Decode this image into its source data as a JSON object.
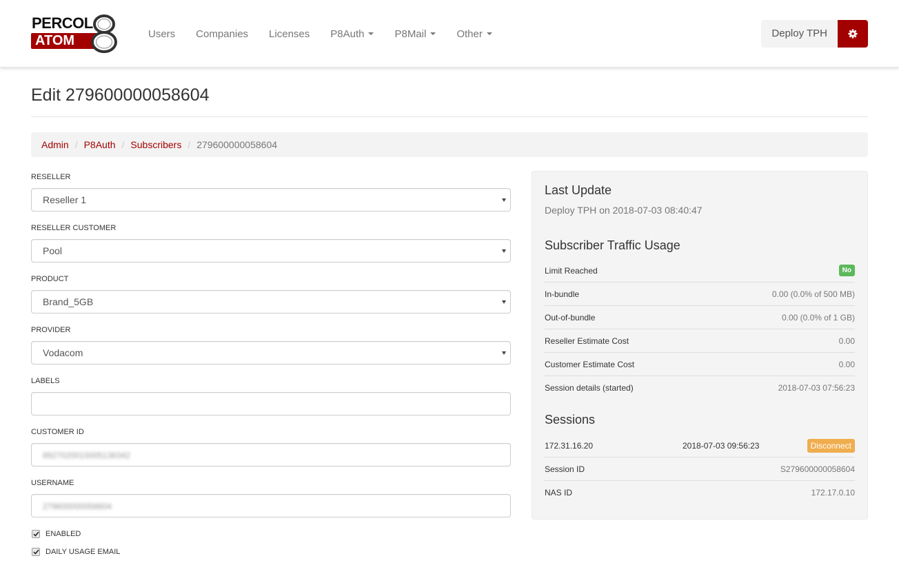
{
  "brand": {
    "line1": "PERCOL",
    "line2": "ATOM",
    "mark": "8",
    "accent_color": "#a30000"
  },
  "nav": {
    "items": [
      {
        "label": "Users",
        "dropdown": false
      },
      {
        "label": "Companies",
        "dropdown": false
      },
      {
        "label": "Licenses",
        "dropdown": false
      },
      {
        "label": "P8Auth",
        "dropdown": true
      },
      {
        "label": "P8Mail",
        "dropdown": true
      },
      {
        "label": "Other",
        "dropdown": true
      }
    ],
    "deploy_label": "Deploy TPH",
    "settings_icon": "gear-icon"
  },
  "page": {
    "title": "Edit 279600000058604"
  },
  "breadcrumb": {
    "items": [
      "Admin",
      "P8Auth",
      "Subscribers"
    ],
    "current": "279600000058604",
    "separator": "/"
  },
  "form": {
    "reseller": {
      "label": "RESELLER",
      "value": "Reseller 1"
    },
    "reseller_customer": {
      "label": "RESELLER CUSTOMER",
      "value": "Pool"
    },
    "product": {
      "label": "PRODUCT",
      "value": "Brand_5GB"
    },
    "provider": {
      "label": "PROVIDER",
      "value": "Vodacom"
    },
    "labels": {
      "label": "LABELS",
      "value": ""
    },
    "customer_id": {
      "label": "CUSTOMER ID",
      "value": "8927020015005136342"
    },
    "username": {
      "label": "USERNAME",
      "value": "279600000058604"
    },
    "enabled": {
      "label": "ENABLED",
      "checked": true
    },
    "daily_usage_email": {
      "label": "DAILY USAGE EMAIL",
      "checked": true
    }
  },
  "panel": {
    "last_update": {
      "heading": "Last Update",
      "text": "Deploy TPH on 2018-07-03 08:40:47"
    },
    "traffic": {
      "heading": "Subscriber Traffic Usage",
      "limit_reached_label": "Limit Reached",
      "limit_reached_value": "No",
      "rows": [
        {
          "key": "In-bundle",
          "value": "0.00 (0.0% of 500 MB)"
        },
        {
          "key": "Out-of-bundle",
          "value": "0.00 (0.0% of 1 GB)"
        },
        {
          "key": "Reseller Estimate Cost",
          "value": "0.00"
        },
        {
          "key": "Customer Estimate Cost",
          "value": "0.00"
        },
        {
          "key": "Session details (started)",
          "value": "2018-07-03 07:56:23"
        }
      ]
    },
    "sessions": {
      "heading": "Sessions",
      "ip": "172.31.16.20",
      "time": "2018-07-03 09:56:23",
      "disconnect_label": "Disconnect",
      "rows": [
        {
          "key": "Session ID",
          "value": "S279600000058604"
        },
        {
          "key": "NAS ID",
          "value": "172.17.0.10"
        }
      ]
    },
    "colors": {
      "success": "#5cb85c",
      "warning": "#f0ad4e"
    }
  }
}
